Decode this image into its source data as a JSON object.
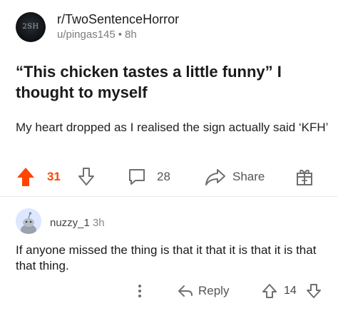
{
  "post": {
    "subreddit": "r/TwoSentenceHorror",
    "subreddit_icon_text": "2SH",
    "author": "u/pingas145",
    "separator": "•",
    "age": "8h",
    "title": "“This chicken tastes a little funny” I thought to myself",
    "body": "My heart dropped as I realised the sign actually said ‘KFH’",
    "upvotes": "31",
    "comments": "28",
    "share_label": "Share",
    "upvoted": true
  },
  "comment": {
    "username": "nuzzy_1",
    "age": "3h",
    "body": "If anyone missed the thing is that it that it is that it is that that thing.",
    "reply_label": "Reply",
    "score": "14"
  },
  "colors": {
    "upvote_active": "#ff4500",
    "icon_gray": "#6f6f6f"
  }
}
